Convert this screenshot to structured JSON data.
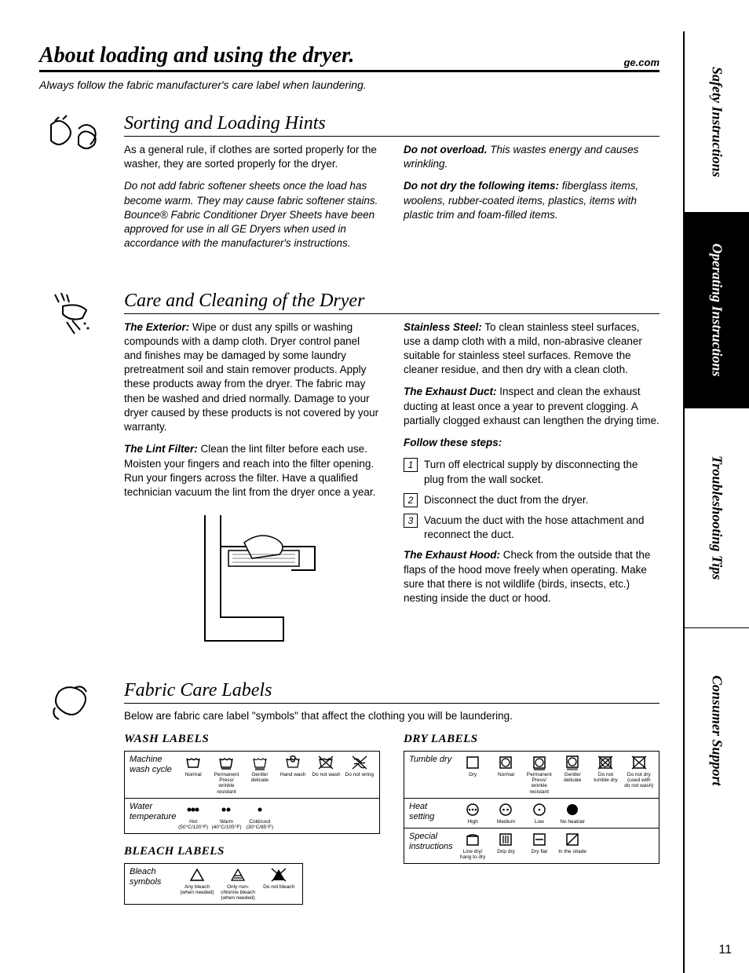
{
  "header": {
    "title": "About loading and using the dryer.",
    "url": "ge.com"
  },
  "subhead": "Always follow the fabric manufacturer's care label when laundering.",
  "sidebar": {
    "tab1": "Safety Instructions",
    "tab2": "Operating Instructions",
    "tab3": "Troubleshooting Tips",
    "tab4": "Consumer Support"
  },
  "sorting": {
    "heading": "Sorting and Loading Hints",
    "p1": "As a general rule, if clothes are sorted properly for the washer, they are sorted properly for the dryer.",
    "p2": "Do not add fabric softener sheets once the load has become warm. They may cause fabric softener stains. Bounce® Fabric Conditioner Dryer Sheets have been approved for use in all GE Dryers when used in accordance with the manufacturer's instructions.",
    "p3_bold": "Do not overload.",
    "p3_rest": " This wastes energy and causes wrinkling.",
    "p4_bold": "Do not dry the following items:",
    "p4_rest": " fiberglass items, woolens, rubber-coated items, plastics, items with plastic trim and foam-filled items."
  },
  "care": {
    "heading": "Care and Cleaning of the Dryer",
    "ext_label": "The Exterior:",
    "ext_text": " Wipe or dust any spills or washing compounds with a damp cloth. Dryer control panel and finishes may be damaged by some laundry pretreatment soil and stain remover products. Apply these products away from the dryer. The fabric may then be washed and dried normally. Damage to your dryer caused by these products is not covered by your warranty.",
    "lint_label": "The Lint Filter:",
    "lint_text": " Clean the lint filter before each use. Moisten your fingers and reach into the filter opening. Run your fingers across the filter. Have a qualified technician vacuum the lint from the dryer once a year.",
    "ss_label": "Stainless Steel:",
    "ss_text": " To clean stainless steel surfaces, use a damp cloth with a mild, non-abrasive cleaner suitable for stainless steel surfaces. Remove the cleaner residue, and then dry with a clean cloth.",
    "duct_label": "The Exhaust Duct:",
    "duct_text": " Inspect and clean the exhaust ducting at least once a year to prevent clogging. A partially clogged exhaust can lengthen the drying time.",
    "steps_label": "Follow these steps:",
    "step1": "Turn off electrical supply by disconnecting the plug from the wall socket.",
    "step2": "Disconnect the duct from the dryer.",
    "step3": "Vacuum the duct with the hose attachment and reconnect the duct.",
    "hood_label": "The Exhaust Hood:",
    "hood_text": " Check from the outside that the flaps of the hood move freely when operating. Make sure that there is not wildlife (birds, insects, etc.) nesting inside the duct or hood."
  },
  "fabric": {
    "heading": "Fabric Care Labels",
    "intro": "Below are fabric care label \"symbols\" that affect the clothing you will be laundering.",
    "wash_title": "WASH LABELS",
    "bleach_title": "BLEACH LABELS",
    "dry_title": "DRY LABELS",
    "wash": {
      "r1_title": "Machine wash cycle",
      "r1": [
        "Normal",
        "Permanent Press/ wrinkle resistant",
        "Gentle/ delicate",
        "Hand wash",
        "Do not wash",
        "Do not wring"
      ],
      "r2_title": "Water temperature",
      "r2": [
        "Hot (50°C/120°F)",
        "Warm (40°C/105°F)",
        "Cold/cool (30°C/85°F)"
      ]
    },
    "bleach": {
      "r1_title": "Bleach symbols",
      "r1": [
        "Any bleach (when needed)",
        "Only non-chlorine bleach (when needed)",
        "Do not bleach"
      ]
    },
    "dry": {
      "r1_title": "Tumble dry",
      "r1": [
        "Dry",
        "Normal",
        "Permanent Press/ wrinkle resistant",
        "Gentle/ delicate",
        "Do not tumble dry",
        "Do not dry (used with do not wash)"
      ],
      "r2_title": "Heat setting",
      "r2": [
        "High",
        "Medium",
        "Low",
        "No heat/air"
      ],
      "r3_title": "Special instructions",
      "r3": [
        "Line dry/ hang to dry",
        "Drip dry",
        "Dry flat",
        "In the shade"
      ]
    }
  },
  "page_num": "11"
}
